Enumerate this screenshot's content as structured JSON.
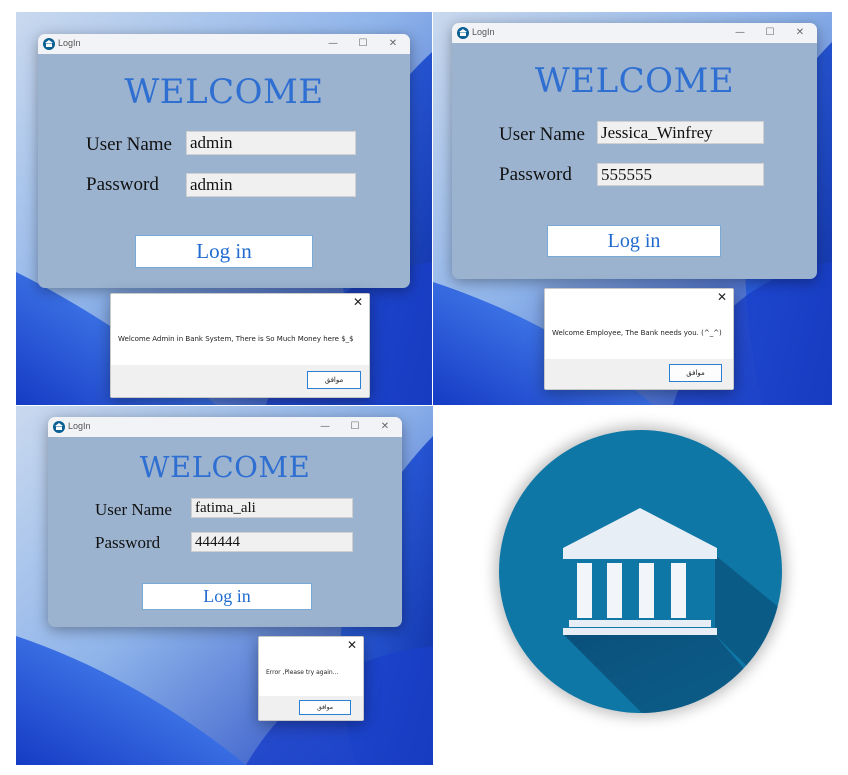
{
  "window": {
    "title": "LogIn",
    "minimize_glyph": "—",
    "maximize_glyph": "☐",
    "close_glyph": "✕",
    "app_icon": "bank-icon"
  },
  "form": {
    "welcome": "WELCOME",
    "username_label": "User Name",
    "password_label": "Password",
    "login_label": "Log in"
  },
  "screens": [
    {
      "username": "admin",
      "password": "admin",
      "dialog_message": "Welcome Admin in Bank System, There is So Much Money here $_$",
      "dialog_ok": "موافق"
    },
    {
      "username": "Jessica_Winfrey",
      "password": "555555",
      "dialog_message": "Welcome Employee, The Bank needs you. (^_^)",
      "dialog_ok": "موافق"
    },
    {
      "username": "fatima_ali",
      "password": "444444",
      "dialog_message": "Error ,Please try again...",
      "dialog_ok": "موافق"
    }
  ],
  "dialog": {
    "close_glyph": "✕"
  },
  "colors": {
    "window_bg": "#9bb3cf",
    "welcome_text": "#2f6fd1",
    "login_text": "#1f6bd0",
    "logo_bg": "#0f77a6",
    "desktop_blue": "#1546c8"
  },
  "logo": {
    "icon": "bank-building-icon"
  }
}
